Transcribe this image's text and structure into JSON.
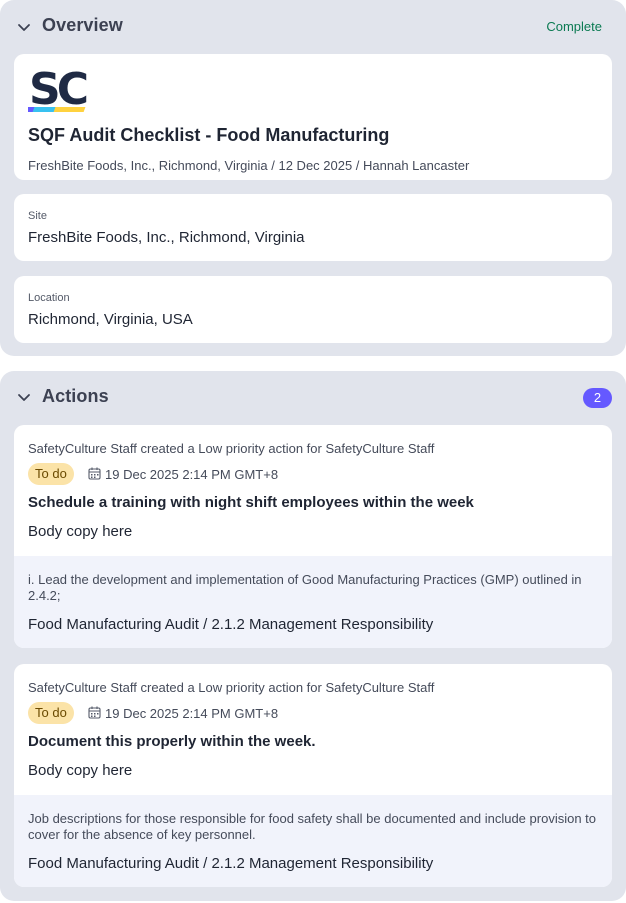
{
  "overview": {
    "title": "Overview",
    "status": "Complete",
    "status_color": "#0b7a52",
    "logo_text": "SC",
    "doc_title": "SQF Audit Checklist - Food Manufacturing",
    "doc_subtitle": "FreshBite Foods, Inc., Richmond, Virginia / 12 Dec 2025 / Hannah Lancaster",
    "site_label": "Site",
    "site_value": "FreshBite Foods, Inc., Richmond, Virginia",
    "location_label": "Location",
    "location_value": "Richmond, Virginia, USA"
  },
  "actions": {
    "title": "Actions",
    "count": "2",
    "accent": "#6559ff",
    "items": [
      {
        "meta": "SafetyCulture Staff created a Low priority action for SafetyCulture Staff",
        "status": "To do",
        "due": "19 Dec 2025 2:14 PM GMT+8",
        "title": "Schedule a training with night shift employees within the week",
        "body": "Body copy here",
        "reference": "i. Lead the development and implementation of Good Manufacturing Practices (GMP) outlined in 2.4.2;",
        "path": "Food Manufacturing Audit / 2.1.2 Management Responsibility"
      },
      {
        "meta": "SafetyCulture Staff created a Low priority action for SafetyCulture Staff",
        "status": "To do",
        "due": "19 Dec 2025 2:14 PM GMT+8",
        "title": "Document this properly within the week.",
        "body": "Body copy here",
        "reference": "Job descriptions for those responsible for food safety shall be documented and include provision to cover for the absence of key personnel.",
        "path": "Food Manufacturing Audit / 2.1.2 Management Responsibility"
      }
    ]
  },
  "icons": {
    "collapse": "chevron-down-icon",
    "due_date": "calendar-icon"
  }
}
